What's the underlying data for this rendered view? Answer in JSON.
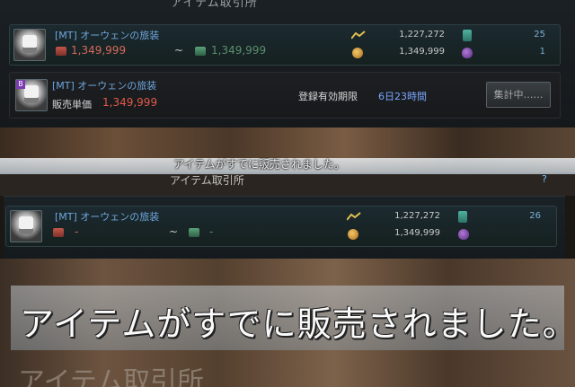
{
  "window_title": "アイテム取引所",
  "listing_top": {
    "item_name": "[MT] オーウェンの旅装",
    "min_price": "1,349,999",
    "max_price": "1,349,999",
    "tilde": "~",
    "stat_recent_price": "1,227,272",
    "stat_base_price": "1,349,999",
    "stat_count_listed": "25",
    "stat_count_pre": "1"
  },
  "selling_row": {
    "badge": "B",
    "item_name": "[MT] オーウェンの旅装",
    "sale_label": "販売単価",
    "sale_price": "1,349,999",
    "expiry_label": "登録有効期限",
    "expiry_value": "6日23時間",
    "tally_button": "集計中……"
  },
  "notice_small": "アイテムがすでに販売されました。",
  "subtitle_small": "アイテム取引所",
  "help_mark": "?",
  "listing_bottom": {
    "item_name": "[MT] オーウェンの旅装",
    "min_price": "-",
    "max_price": "-",
    "tilde": "~",
    "stat_recent_price": "1,227,272",
    "stat_base_price": "1,349,999",
    "stat_count_listed": "26"
  },
  "notice_big": "アイテムがすでに販売されました。",
  "subtitle_big": "アイテム取引所"
}
